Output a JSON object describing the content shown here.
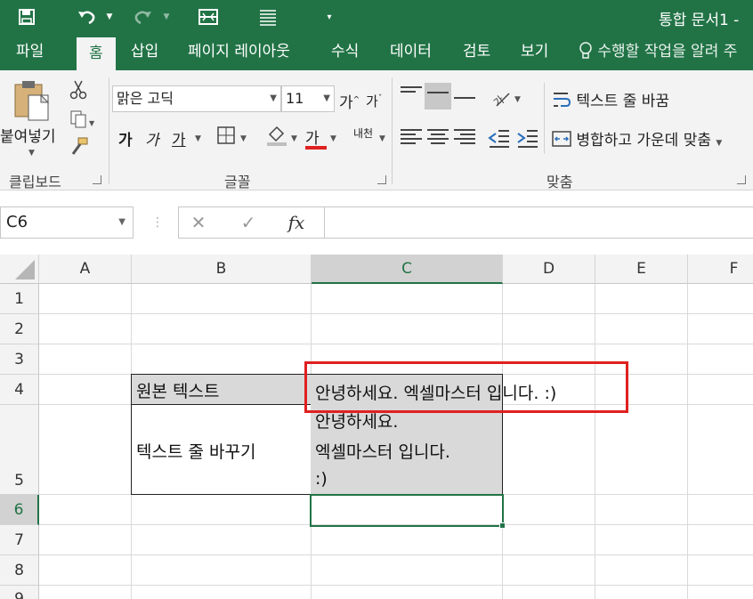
{
  "title_bar": {
    "title": "통합 문서1 -"
  },
  "tabs": [
    "파일",
    "홈",
    "삽입",
    "페이지 레이아웃",
    "수식",
    "데이터",
    "검토",
    "보기"
  ],
  "tell_me": "수행할 작업을 알려 주",
  "ribbon": {
    "clipboard": {
      "paste_label": "붙여넣기",
      "group_label": "클립보드"
    },
    "font": {
      "font_name": "맑은 고딕",
      "font_size": "11",
      "grow": "가",
      "shrink": "가",
      "bold": "가",
      "italic": "가",
      "underline": "가",
      "font_color_glyph": "가",
      "phonetic": "내천",
      "group_label": "글꼴"
    },
    "alignment": {
      "wrap_text": "텍스트 줄 바꿈",
      "merge_center": "병합하고 가운데 맞춤",
      "group_label": "맞춤"
    }
  },
  "formula_bar": {
    "name_box": "C6",
    "cancel": "✕",
    "enter": "✓",
    "fx": "fx",
    "value": ""
  },
  "columns": [
    "A",
    "B",
    "C",
    "D",
    "E",
    "F"
  ],
  "rows": [
    "1",
    "2",
    "3",
    "4",
    "5",
    "6",
    "7",
    "8",
    "9"
  ],
  "cells": {
    "B4": "원본 텍스트",
    "C4": "안녕하세요. 엑셀마스터 입니다. :)",
    "B5": "텍스트 줄 바꾸기",
    "C5_line1": "안녕하세요.",
    "C5_line2": "엑셀마스터 입니다.",
    "C5_line3": ":)"
  },
  "selected_cell": "C6",
  "colors": {
    "accent": "#217346",
    "highlight_box": "#e02020",
    "cell_fill": "#d9d9d9"
  }
}
